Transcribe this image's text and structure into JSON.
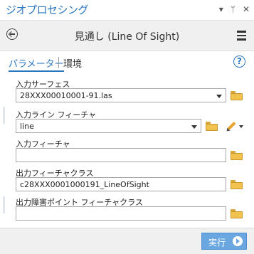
{
  "pane": {
    "title": "ジオプロセシング",
    "icons": [
      "chevron-down-icon",
      "pin-icon",
      "close-icon"
    ]
  },
  "tool": {
    "title": "見通し (Line Of Sight)"
  },
  "tabs": {
    "parameters": "パラメーター",
    "environments": "環境",
    "help": "?"
  },
  "params": {
    "input_surface": {
      "label": "入力サーフェス",
      "value": "28XXX00010001-91.las"
    },
    "input_line": {
      "label": "入力ライン フィーチャ",
      "value": "line"
    },
    "input_features": {
      "label": "入力フィーチャ",
      "value": ""
    },
    "output_features": {
      "label": "出力フィーチャクラス",
      "value": "c28XXX0001000191_LineOfSight"
    },
    "output_obstruction": {
      "label": "出力障害ポイント フィーチャクラス",
      "value": ""
    }
  },
  "footer": {
    "run_label": "実行"
  },
  "colors": {
    "accent": "#2a76bf",
    "run_button": "#6aa6df",
    "folder": "#f2c24f"
  }
}
